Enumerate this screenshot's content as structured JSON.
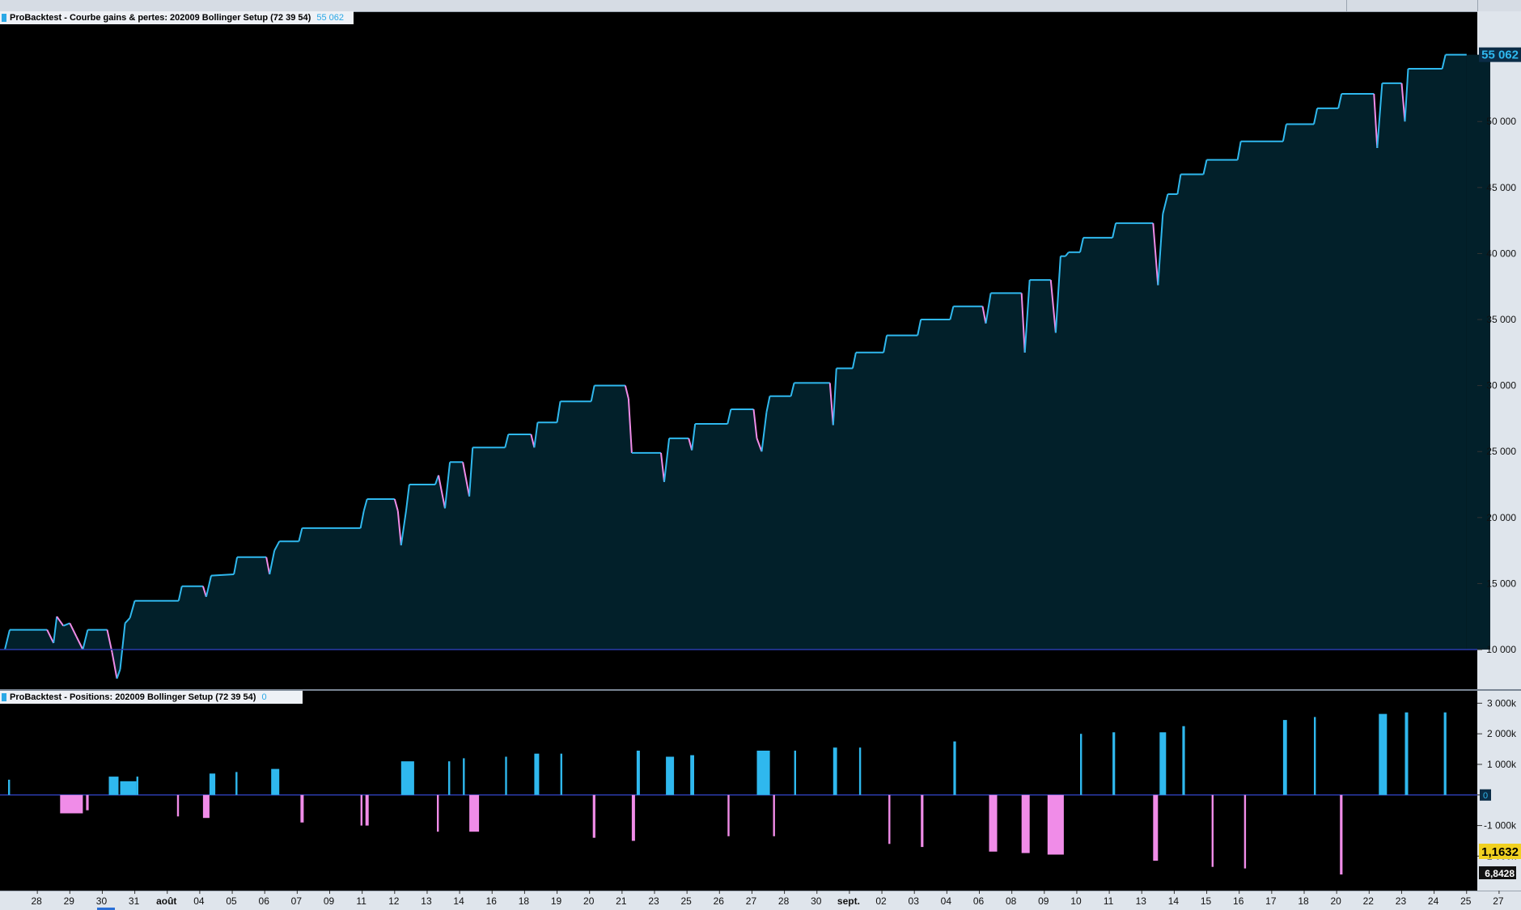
{
  "panel1": {
    "title": "ProBacktest - Courbe gains & pertes: 202009 Bollinger Setup (72 39 54)",
    "value": "55 062"
  },
  "panel2": {
    "title": "ProBacktest - Positions: 202009 Bollinger Setup (72 39 54)",
    "value": "0"
  },
  "side_labels": {
    "price": "1,1632",
    "ratio": "6,8428"
  },
  "colors": {
    "gain": "#2fb8ee",
    "loss": "#f08ce8",
    "fill": "#02202a",
    "baseline": "#2a3aaa"
  },
  "chart_data": [
    {
      "type": "area",
      "title": "ProBacktest - Courbe gains & pertes: 202009 Bollinger Setup (72 39 54)",
      "ylim": [
        7000,
        57000
      ],
      "yticks": [
        10000,
        15000,
        20000,
        25000,
        30000,
        35000,
        40000,
        45000,
        50000
      ],
      "ytick_labels": [
        "10 000",
        "15 000",
        "20 000",
        "25 000",
        "30 000",
        "35 000",
        "40 000",
        "45 000",
        "50 000"
      ],
      "last_value_label": "55 062",
      "baseline": 10000,
      "x_categories": [
        "28",
        "29",
        "30",
        "31",
        "août",
        "04",
        "05",
        "06",
        "07",
        "09",
        "11",
        "12",
        "13",
        "14",
        "16",
        "18",
        "19",
        "20",
        "21",
        "23",
        "25",
        "26",
        "27",
        "28",
        "30",
        "sept.",
        "02",
        "03",
        "04",
        "06",
        "08",
        "09",
        "10",
        "11",
        "13",
        "14",
        "15",
        "16",
        "17",
        "18",
        "20",
        "22",
        "23",
        "24",
        "25",
        "27"
      ],
      "series": [
        {
          "values": [
            [
              0,
              10000
            ],
            [
              0.15,
              11500
            ],
            [
              1.3,
              11500
            ],
            [
              1.5,
              10500
            ],
            [
              1.6,
              12500
            ],
            [
              1.8,
              11800
            ],
            [
              2.0,
              12000
            ],
            [
              2.2,
              11000
            ],
            [
              2.4,
              10000
            ],
            [
              2.55,
              11500
            ],
            [
              3.15,
              11500
            ],
            [
              3.3,
              9800
            ],
            [
              3.45,
              7800
            ],
            [
              3.55,
              8500
            ],
            [
              3.7,
              12000
            ],
            [
              3.85,
              12400
            ],
            [
              4.0,
              13700
            ],
            [
              5.35,
              13700
            ],
            [
              5.45,
              14800
            ],
            [
              6.1,
              14800
            ],
            [
              6.2,
              14000
            ],
            [
              6.35,
              15600
            ],
            [
              7.05,
              15700
            ],
            [
              7.15,
              17000
            ],
            [
              8.05,
              17000
            ],
            [
              8.15,
              15700
            ],
            [
              8.3,
              17500
            ],
            [
              8.45,
              18200
            ],
            [
              9.05,
              18200
            ],
            [
              9.15,
              19200
            ],
            [
              10.95,
              19200
            ],
            [
              11.05,
              20500
            ],
            [
              11.15,
              21400
            ],
            [
              12.0,
              21400
            ],
            [
              12.1,
              20500
            ],
            [
              12.2,
              17900
            ],
            [
              12.35,
              20500
            ],
            [
              12.45,
              22500
            ],
            [
              13.25,
              22500
            ],
            [
              13.35,
              23200
            ],
            [
              13.55,
              20700
            ],
            [
              13.7,
              24200
            ],
            [
              14.1,
              24200
            ],
            [
              14.3,
              21600
            ],
            [
              14.4,
              25300
            ],
            [
              15.4,
              25300
            ],
            [
              15.5,
              26300
            ],
            [
              16.2,
              26300
            ],
            [
              16.3,
              25300
            ],
            [
              16.4,
              27200
            ],
            [
              17.0,
              27200
            ],
            [
              17.1,
              28800
            ],
            [
              18.05,
              28800
            ],
            [
              18.15,
              30000
            ],
            [
              19.1,
              30000
            ],
            [
              19.2,
              29000
            ],
            [
              19.3,
              24900
            ],
            [
              20.2,
              24900
            ],
            [
              20.3,
              22700
            ],
            [
              20.45,
              26000
            ],
            [
              21.05,
              26000
            ],
            [
              21.15,
              25100
            ],
            [
              21.25,
              27100
            ],
            [
              22.25,
              27100
            ],
            [
              22.35,
              28200
            ],
            [
              23.05,
              28200
            ],
            [
              23.15,
              26000
            ],
            [
              23.3,
              25000
            ],
            [
              23.45,
              28000
            ],
            [
              23.55,
              29200
            ],
            [
              24.2,
              29200
            ],
            [
              24.3,
              30200
            ],
            [
              25.4,
              30200
            ],
            [
              25.5,
              27000
            ],
            [
              25.6,
              31300
            ],
            [
              26.1,
              31300
            ],
            [
              26.2,
              32500
            ],
            [
              27.05,
              32500
            ],
            [
              27.15,
              33800
            ],
            [
              28.1,
              33800
            ],
            [
              28.2,
              35000
            ],
            [
              29.1,
              35000
            ],
            [
              29.2,
              36000
            ],
            [
              30.1,
              36000
            ],
            [
              30.2,
              34700
            ],
            [
              30.35,
              37000
            ],
            [
              31.3,
              37000
            ],
            [
              31.4,
              32500
            ],
            [
              31.55,
              38000
            ],
            [
              32.2,
              38000
            ],
            [
              32.35,
              34000
            ],
            [
              32.5,
              39800
            ],
            [
              32.65,
              39800
            ],
            [
              32.75,
              40100
            ],
            [
              33.1,
              40100
            ],
            [
              33.2,
              41200
            ],
            [
              34.1,
              41200
            ],
            [
              34.2,
              42300
            ],
            [
              35.35,
              42300
            ],
            [
              35.5,
              37600
            ],
            [
              35.65,
              43000
            ],
            [
              35.8,
              44500
            ],
            [
              36.1,
              44500
            ],
            [
              36.2,
              46000
            ],
            [
              36.9,
              46000
            ],
            [
              37.0,
              47100
            ],
            [
              37.95,
              47100
            ],
            [
              38.05,
              48500
            ],
            [
              39.35,
              48500
            ],
            [
              39.45,
              49800
            ],
            [
              40.3,
              49800
            ],
            [
              40.4,
              51000
            ],
            [
              41.05,
              51000
            ],
            [
              41.15,
              52100
            ],
            [
              42.15,
              52100
            ],
            [
              42.25,
              48000
            ],
            [
              42.4,
              52900
            ],
            [
              43.0,
              52900
            ],
            [
              43.1,
              50000
            ],
            [
              43.2,
              54000
            ],
            [
              44.25,
              54000
            ],
            [
              44.35,
              55062
            ],
            [
              45.0,
              55062
            ]
          ]
        }
      ]
    },
    {
      "type": "bar",
      "title": "ProBacktest - Positions: 202009 Bollinger Setup (72 39 54)",
      "ylim": [
        -3100,
        3300
      ],
      "yticks": [
        3000,
        2000,
        1000,
        0,
        -1000,
        -2000
      ],
      "ytick_labels": [
        "3 000k",
        "2 000k",
        "1 000k",
        "0",
        "-1 000k",
        "-2 000k"
      ],
      "last_value_label": "0",
      "bars": [
        {
          "x": 0.1,
          "w": 0.06,
          "v": 500
        },
        {
          "x": 1.7,
          "w": 0.7,
          "v": -600
        },
        {
          "x": 2.5,
          "w": 0.08,
          "v": -500
        },
        {
          "x": 3.2,
          "w": 0.3,
          "v": 600
        },
        {
          "x": 3.55,
          "w": 0.5,
          "v": 450
        },
        {
          "x": 4.05,
          "w": 0.06,
          "v": 600
        },
        {
          "x": 5.3,
          "w": 0.06,
          "v": -700
        },
        {
          "x": 6.1,
          "w": 0.2,
          "v": -750
        },
        {
          "x": 6.3,
          "w": 0.18,
          "v": 700
        },
        {
          "x": 7.1,
          "w": 0.06,
          "v": 750
        },
        {
          "x": 8.2,
          "w": 0.25,
          "v": 850
        },
        {
          "x": 9.1,
          "w": 0.1,
          "v": -900
        },
        {
          "x": 10.95,
          "w": 0.06,
          "v": -1000
        },
        {
          "x": 11.1,
          "w": 0.1,
          "v": -1000
        },
        {
          "x": 12.2,
          "w": 0.4,
          "v": 1100
        },
        {
          "x": 13.3,
          "w": 0.06,
          "v": -1200
        },
        {
          "x": 13.65,
          "w": 0.06,
          "v": 1100
        },
        {
          "x": 14.1,
          "w": 0.06,
          "v": 1200
        },
        {
          "x": 14.3,
          "w": 0.3,
          "v": -1200
        },
        {
          "x": 15.4,
          "w": 0.06,
          "v": 1250
        },
        {
          "x": 16.3,
          "w": 0.15,
          "v": 1350
        },
        {
          "x": 17.1,
          "w": 0.06,
          "v": 1350
        },
        {
          "x": 18.1,
          "w": 0.08,
          "v": -1400
        },
        {
          "x": 19.3,
          "w": 0.1,
          "v": -1500
        },
        {
          "x": 19.45,
          "w": 0.1,
          "v": 1450
        },
        {
          "x": 20.35,
          "w": 0.25,
          "v": 1250
        },
        {
          "x": 21.1,
          "w": 0.12,
          "v": 1300
        },
        {
          "x": 22.25,
          "w": 0.06,
          "v": -1350
        },
        {
          "x": 23.15,
          "w": 0.4,
          "v": 1450
        },
        {
          "x": 23.65,
          "w": 0.06,
          "v": -1350
        },
        {
          "x": 24.3,
          "w": 0.06,
          "v": 1450
        },
        {
          "x": 25.5,
          "w": 0.12,
          "v": 1550
        },
        {
          "x": 26.3,
          "w": 0.06,
          "v": 1550
        },
        {
          "x": 27.2,
          "w": 0.06,
          "v": -1600
        },
        {
          "x": 28.2,
          "w": 0.08,
          "v": -1700
        },
        {
          "x": 29.2,
          "w": 0.08,
          "v": 1750
        },
        {
          "x": 30.3,
          "w": 0.25,
          "v": -1850
        },
        {
          "x": 31.3,
          "w": 0.25,
          "v": -1900
        },
        {
          "x": 32.1,
          "w": 0.5,
          "v": -1950
        },
        {
          "x": 33.1,
          "w": 0.06,
          "v": 2000
        },
        {
          "x": 34.1,
          "w": 0.08,
          "v": 2050
        },
        {
          "x": 35.35,
          "w": 0.15,
          "v": -2150
        },
        {
          "x": 35.55,
          "w": 0.2,
          "v": 2050
        },
        {
          "x": 36.25,
          "w": 0.08,
          "v": 2250
        },
        {
          "x": 37.15,
          "w": 0.06,
          "v": -2350
        },
        {
          "x": 38.15,
          "w": 0.06,
          "v": -2400
        },
        {
          "x": 39.35,
          "w": 0.12,
          "v": 2450
        },
        {
          "x": 40.3,
          "w": 0.06,
          "v": 2550
        },
        {
          "x": 41.1,
          "w": 0.08,
          "v": -2600
        },
        {
          "x": 42.3,
          "w": 0.25,
          "v": 2650
        },
        {
          "x": 43.1,
          "w": 0.1,
          "v": 2700
        },
        {
          "x": 44.3,
          "w": 0.08,
          "v": 2700
        }
      ]
    }
  ]
}
